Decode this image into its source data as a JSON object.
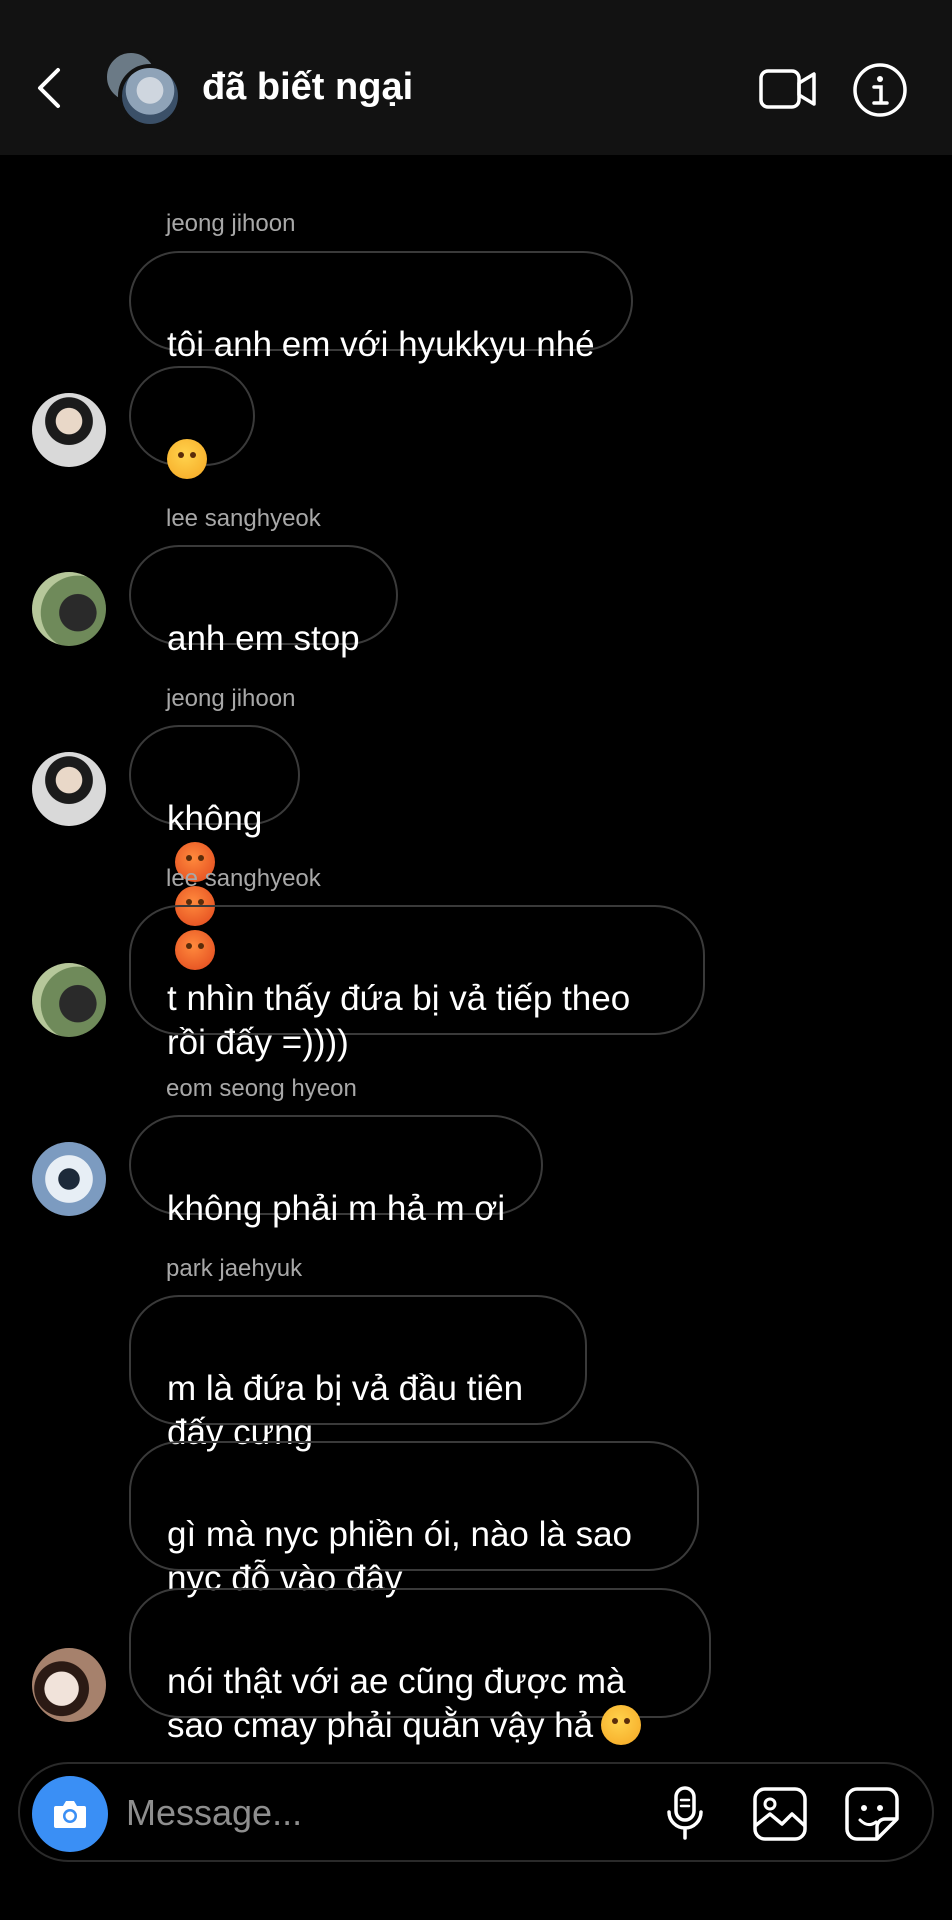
{
  "header": {
    "title": "đã biết ngại",
    "back_icon": "chevron-left-icon",
    "video_icon": "video-call-icon",
    "info_icon": "info-icon"
  },
  "messages": [
    {
      "sender": "jeong jihoon",
      "text": "tôi anh em với hyukkyu nhé"
    },
    {
      "text": "",
      "emoji": "smirk"
    },
    {
      "sender": "lee sanghyeok",
      "text": "anh em stop"
    },
    {
      "sender": "jeong jihoon",
      "text": "không",
      "emoji": "angry x3"
    },
    {
      "sender": "lee sanghyeok",
      "text": "t nhìn thấy đứa bị vả tiếp theo\nrồi đấy =))))"
    },
    {
      "sender": "eom seong hyeon",
      "text": "không phải m hả m ơi"
    },
    {
      "sender": "park jaehyuk",
      "text": "m là đứa bị vả đầu tiên\nđấy cưng"
    },
    {
      "text": "gì mà nyc phiền ói, nào là sao\nnyc đỗ vào đây"
    },
    {
      "text": "nói thật với ae cũng được mà\nsao cmay phải quằn vậy hả",
      "emoji": "laugh"
    }
  ],
  "composer": {
    "placeholder": "Message...",
    "camera_icon": "camera-icon",
    "mic_icon": "microphone-icon",
    "gallery_icon": "gallery-icon",
    "sticker_icon": "sticker-icon",
    "accent": "#3a8ff5"
  }
}
